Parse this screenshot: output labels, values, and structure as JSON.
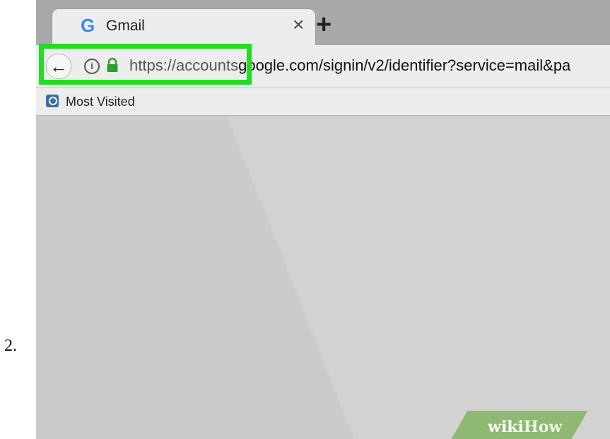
{
  "step_number": "2.",
  "browser": {
    "tab": {
      "favicon": "G",
      "title": "Gmail",
      "close_glyph": "×"
    },
    "new_tab_glyph": "+",
    "navbar": {
      "back_glyph": "←",
      "info_glyph": "i",
      "url_visible_part": "https://accounts",
      "url_rest": "google.com/signin/v2/identifier?service=mail&pa"
    },
    "bookmarks": {
      "most_visited_label": "Most Visited"
    },
    "highlight_color": "#22dd22"
  },
  "watermark": {
    "wiki": "wiki",
    "how": "How"
  }
}
